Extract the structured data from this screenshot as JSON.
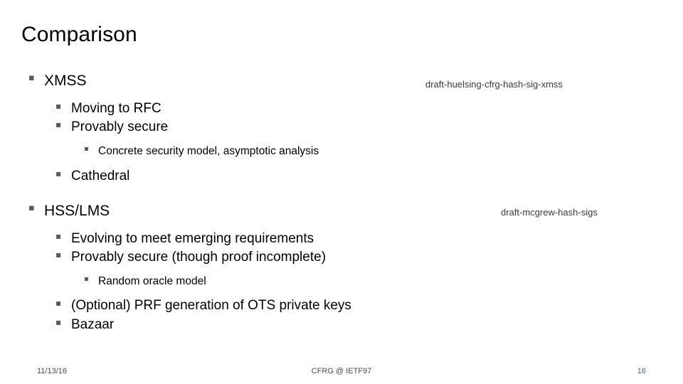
{
  "slide": {
    "title": "Comparison",
    "bullet_glyph": "▪",
    "sections": [
      {
        "heading": "XMSS",
        "draft_label": "draft-huelsing-cfrg-hash-sig-xmss",
        "items": [
          {
            "level": 2,
            "text": "Moving to RFC"
          },
          {
            "level": 2,
            "text": "Provably secure"
          },
          {
            "level": 3,
            "text": "Concrete security model, asymptotic analysis"
          },
          {
            "level": 2,
            "text": "Cathedral"
          }
        ]
      },
      {
        "heading": "HSS/LMS",
        "draft_label": "draft-mcgrew-hash-sigs",
        "items": [
          {
            "level": 2,
            "text": "Evolving to meet emerging requirements"
          },
          {
            "level": 2,
            "text": "Provably secure (though proof incomplete)"
          },
          {
            "level": 3,
            "text": "Random oracle model"
          },
          {
            "level": 2,
            "text": "(Optional) PRF generation of OTS private keys"
          },
          {
            "level": 2,
            "text": "Bazaar"
          }
        ]
      }
    ]
  },
  "footer": {
    "date": "11/13/16",
    "center": "CFRG @ IETF97",
    "page_number": "16"
  }
}
